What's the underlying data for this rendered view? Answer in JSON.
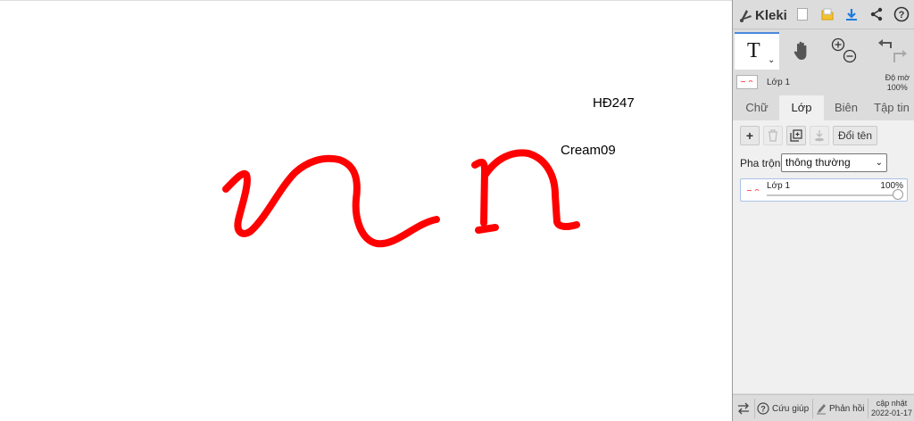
{
  "canvas": {
    "texts": [
      {
        "id": "hd247",
        "text": "HĐ247"
      },
      {
        "id": "cream09",
        "text": "Cream09"
      }
    ],
    "stroke_color": "#ff0000"
  },
  "sidebar": {
    "app_name": "Kleki",
    "top_icons": [
      "new-document-icon",
      "open-folder-icon",
      "download-icon",
      "share-icon",
      "help-icon"
    ],
    "tools": {
      "text_tool_label": "T"
    },
    "current_layer": {
      "name": "Lớp 1",
      "opacity_label": "Độ mờ",
      "opacity_value": "100%"
    },
    "tabs": [
      {
        "label": "Chữ"
      },
      {
        "label": "Lớp"
      },
      {
        "label": "Biên tập"
      },
      {
        "label": "Tập tin"
      }
    ],
    "active_tab": "Lớp",
    "layer_panel": {
      "add_label": "+",
      "rename_label": "Đổi tên",
      "blend_label": "Pha trộn",
      "blend_value": "thông thường",
      "layers": [
        {
          "name": "Lớp 1",
          "opacity": "100%"
        }
      ]
    },
    "footer": {
      "help_label": "Cứu giúp",
      "feedback_label": "Phản hồi",
      "update_label": "cập nhật",
      "update_date": "2022-01-17"
    }
  },
  "colors": {
    "accent": "#4a89dc",
    "sidebar_bg": "#dcdcdc",
    "panel_bg": "#f0f0f0",
    "stroke": "#ff0000"
  }
}
